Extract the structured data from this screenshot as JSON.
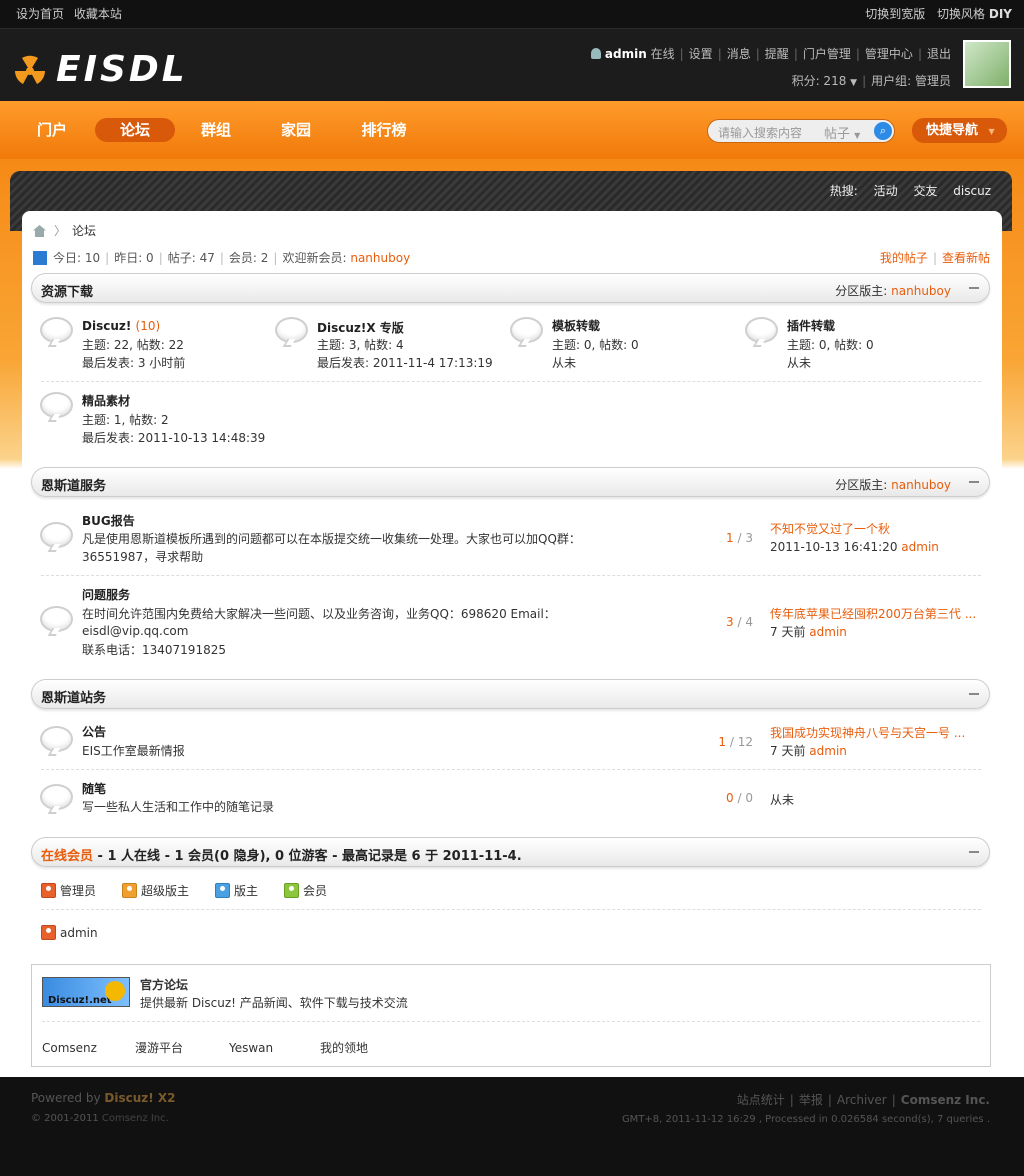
{
  "topbar": {
    "set_home": "设为首页",
    "bookmark": "收藏本站",
    "wide": "切换到宽版",
    "style": "切换风格",
    "diy": "DIY"
  },
  "brand": {
    "logo": "EISDL"
  },
  "user": {
    "name": "admin",
    "status": "在线",
    "links": [
      "设置",
      "消息",
      "提醒",
      "门户管理",
      "管理中心",
      "退出"
    ],
    "points": "积分: 218",
    "group": "用户组: 管理员"
  },
  "nav": {
    "items": [
      "门户",
      "论坛",
      "群组",
      "家园",
      "排行榜"
    ],
    "active": "论坛"
  },
  "search": {
    "placeholder": "请输入搜索内容",
    "type": "帖子",
    "quick": "快捷导航"
  },
  "hot": {
    "label": "热搜:",
    "items": [
      "活动",
      "交友",
      "discuz"
    ]
  },
  "crumb": {
    "current": "论坛"
  },
  "stats": {
    "today": "今日: 10",
    "yesterday": "昨日: 0",
    "posts": "帖子: 47",
    "members": "会员: 2",
    "welcome": "欢迎新会员:",
    "newest": "nanhuboy",
    "my_posts": "我的帖子",
    "new_posts": "查看新帖"
  },
  "sections": [
    {
      "title": "资源下载",
      "mod_label": "分区版主:",
      "mod": "nanhuboy"
    },
    {
      "title": "恩斯道服务",
      "mod_label": "分区版主:",
      "mod": "nanhuboy"
    },
    {
      "title": "恩斯道站务"
    }
  ],
  "grid_forums": [
    {
      "name": "Discuz!",
      "new": "(10)",
      "stat": "主题: 22, 帖数: 22",
      "last": "最后发表: 3 小时前"
    },
    {
      "name": "Discuz!X 专版",
      "stat": "主题: 3, 帖数: 4",
      "last": "最后发表: 2011-11-4 17:13:19"
    },
    {
      "name": "模板转载",
      "stat": "主题: 0, 帖数: 0",
      "last": "从未"
    },
    {
      "name": "插件转载",
      "stat": "主题: 0, 帖数: 0",
      "last": "从未"
    },
    {
      "name": "精品素材",
      "stat": "主题: 1, 帖数: 2",
      "last": "最后发表: 2011-10-13 14:48:39"
    }
  ],
  "list_forums": [
    {
      "name": "BUG报告",
      "desc1": "凡是使用恩斯道模板所遇到的问题都可以在本版提交统一收集统一处理。大家也可以加QQ群：",
      "desc2": "36551987，寻求帮助",
      "threads": "1",
      "posts": "3",
      "last_title": "不知不觉又过了一个秋",
      "last_time": "2011-10-13 16:41:20",
      "last_user": "admin"
    },
    {
      "name": "问题服务",
      "desc1": "在时间允许范围内免费给大家解决一些问题、以及业务咨询，业务QQ：698620 Email：",
      "desc2": "eisdl@vip.qq.com",
      "desc3": "联系电话：13407191825",
      "threads": "3",
      "posts": "4",
      "last_title": "传年底苹果已经囤积200万台第三代 ...",
      "last_time": "7 天前",
      "last_user": "admin"
    },
    {
      "name": "公告",
      "desc1": "EIS工作室最新情报",
      "threads": "1",
      "posts": "12",
      "last_title": "我国成功实现神舟八号与天宫一号 ...",
      "last_time": "7 天前",
      "last_user": "admin"
    },
    {
      "name": "随笔",
      "desc1": "写一些私人生活和工作中的随笔记录",
      "threads": "0",
      "posts": "0",
      "last_none": "从未"
    }
  ],
  "online": {
    "title": "在线会员",
    "summary": "- 1 人在线 - 1 会员(0 隐身), 0 位游客 - 最高记录是 6 于 2011-11-4.",
    "legend": [
      "管理员",
      "超级版主",
      "版主",
      "会员"
    ],
    "users": [
      "admin"
    ],
    "colors": [
      "#e8602c",
      "#f0a030",
      "#4aa0e0",
      "#8cc63e"
    ]
  },
  "links": {
    "logo_text": "Discuz!.net",
    "title": "官方论坛",
    "desc": "提供最新 Discuz! 产品新闻、软件下载与技术交流",
    "items": [
      "Comsenz",
      "漫游平台",
      "Yeswan",
      "我的领地"
    ]
  },
  "footer": {
    "powered": "Powered by",
    "product": "Discuz! X2",
    "copyright": "© 2001-2011",
    "company": "Comsenz Inc.",
    "links": [
      "站点统计",
      "举报",
      "Archiver",
      "Comsenz Inc."
    ],
    "info": "GMT+8, 2011-11-12 16:29 , Processed in 0.026584 second(s), 7 queries ."
  }
}
